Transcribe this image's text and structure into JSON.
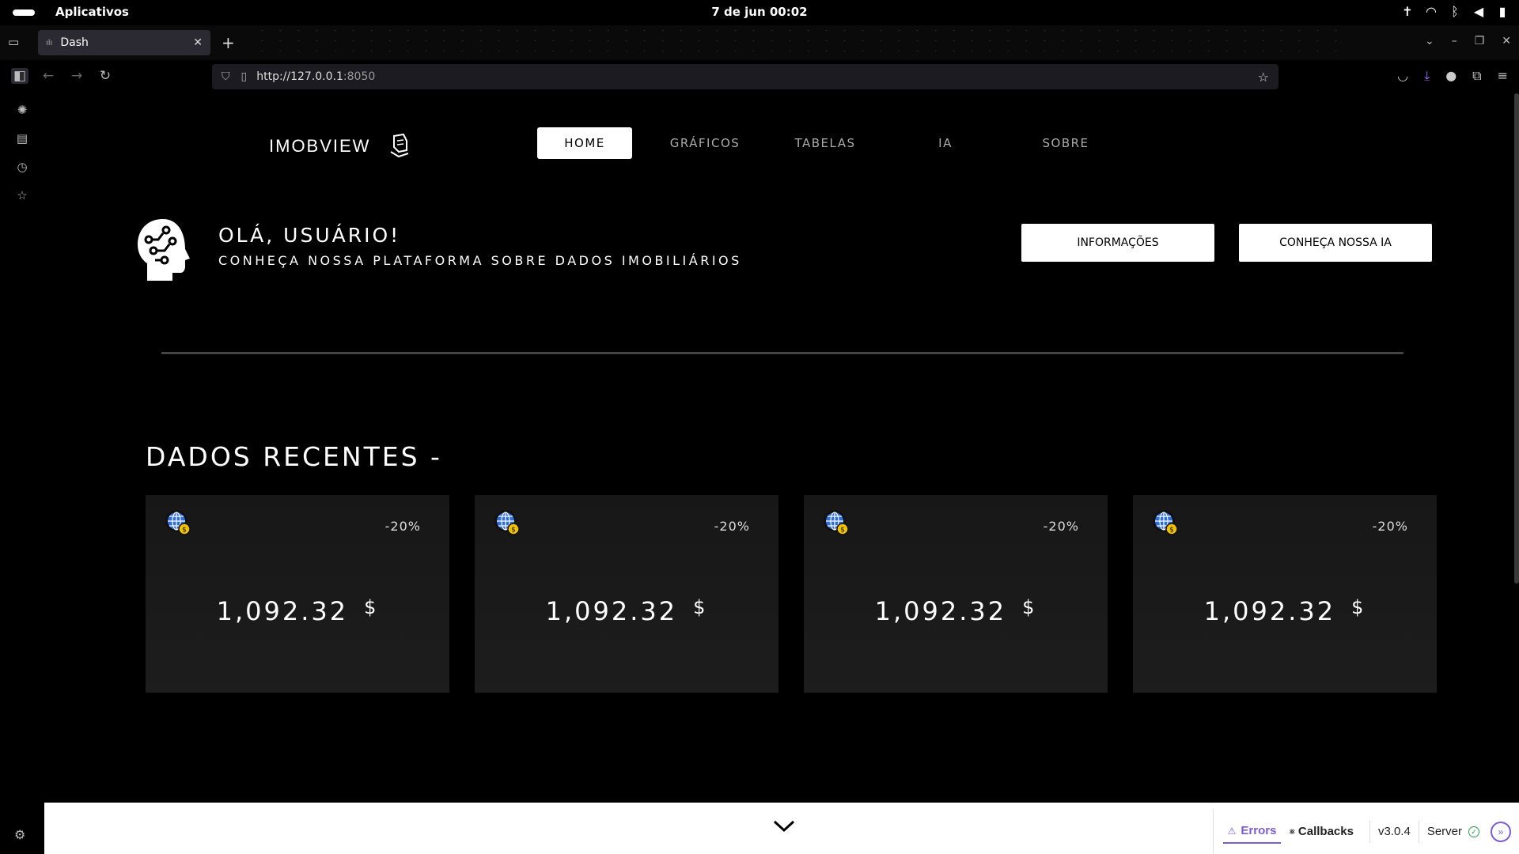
{
  "system": {
    "apps_label": "Aplicativos",
    "datetime": "7 de jun  00:02",
    "tray_icons": [
      "accessibility-icon",
      "wifi-icon",
      "bluetooth-icon",
      "volume-icon",
      "battery-icon"
    ]
  },
  "browser": {
    "tab_title": "Dash",
    "url_prefix": "http://127.0.0.1",
    "url_port": ":8050"
  },
  "site": {
    "logo_text": "IMOBVIEW",
    "menu": [
      "HOME",
      "GRÁFICOS",
      "TABELAS",
      "IA",
      "SOBRE"
    ],
    "active_menu": "HOME",
    "greeting": "OLÁ, USUÁRIO!",
    "subtitle": "CONHEÇA NOSSA PLATAFORMA SOBRE DADOS IMOBILIÁRIOS",
    "buttons": {
      "info": "INFORMAÇÕES",
      "ia": "CONHEÇA NOSSA IA"
    },
    "section_title": "DADOS RECENTES -",
    "cards": [
      {
        "change": "-20%",
        "value": "1,092.32",
        "currency": "$"
      },
      {
        "change": "-20%",
        "value": "1,092.32",
        "currency": "$"
      },
      {
        "change": "-20%",
        "value": "1,092.32",
        "currency": "$"
      },
      {
        "change": "-20%",
        "value": "1,092.32",
        "currency": "$"
      }
    ]
  },
  "devtools": {
    "errors_label": "Errors",
    "callbacks_label": "Callbacks",
    "version": "v3.0.4",
    "server_label": "Server"
  },
  "colors": {
    "background": "#000000",
    "card": "#1a1a1a",
    "globe_blue": "#2f6fdc",
    "coin_yellow": "#f2c200",
    "devtools_accent": "#7b5bd6"
  }
}
